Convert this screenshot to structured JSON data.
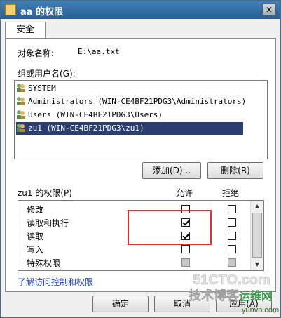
{
  "window": {
    "title": "aa 的权限",
    "close_label": "✕"
  },
  "tabs": [
    {
      "label": "安全"
    }
  ],
  "object": {
    "label": "对象名称:",
    "value": "E:\\aa.txt"
  },
  "group_section": {
    "label": "组或用户名(G):"
  },
  "users": [
    {
      "name": "SYSTEM"
    },
    {
      "name": "Administrators (WIN-CE4BF21PDG3\\Administrators)"
    },
    {
      "name": "Users (WIN-CE4BF21PDG3\\Users)"
    },
    {
      "name": "zu1 (WIN-CE4BF21PDG3\\zu1)",
      "selected": true
    }
  ],
  "buttons": {
    "add": "添加(D)...",
    "remove": "删除(R)",
    "ok": "确定",
    "cancel": "取消",
    "apply": "应用(A)"
  },
  "permissions": {
    "label": "zu1 的权限(P)",
    "allow_header": "允许",
    "deny_header": "拒绝",
    "items": [
      {
        "name": "修改",
        "allow": false,
        "deny": false
      },
      {
        "name": "读取和执行",
        "allow": true,
        "deny": false
      },
      {
        "name": "读取",
        "allow": true,
        "deny": false
      },
      {
        "name": "写入",
        "allow": false,
        "deny": false
      },
      {
        "name": "特殊权限",
        "allow": false,
        "deny": false,
        "disabled": true
      }
    ]
  },
  "link": {
    "text": "了解访问控制和权限"
  },
  "watermark": {
    "line1": "51CTO.com",
    "line2": "技术博客",
    "line3": "运维网",
    "line4": "yunvn.com"
  },
  "colors": {
    "title_bar": "#2f6aa4",
    "selection": "#2a3f6f",
    "highlight_box": "#e03030",
    "link": "#1a3fb0"
  }
}
